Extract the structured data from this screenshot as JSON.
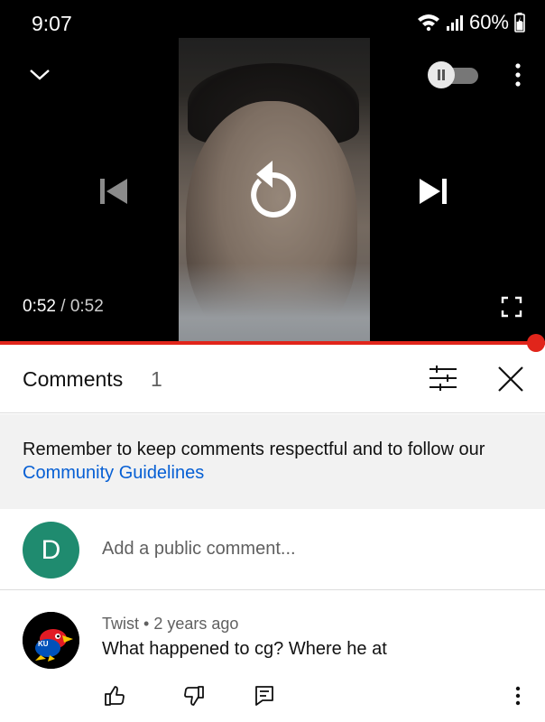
{
  "status_bar": {
    "time": "9:07",
    "battery": "60%",
    "icons": [
      "wifi-icon",
      "signal-icon",
      "battery-icon"
    ]
  },
  "player": {
    "elapsed": "0:52",
    "separator": "/",
    "duration": "0:52",
    "progress_fraction": 1.0,
    "icons": [
      "chevron-down-icon",
      "autoplay-toggle",
      "more-vert-icon",
      "skip-previous-icon",
      "replay-icon",
      "skip-next-icon",
      "fullscreen-icon"
    ]
  },
  "comments": {
    "title": "Comments",
    "count": "1",
    "guidelines_text": "Remember to keep comments respectful and to follow our ",
    "guidelines_link": "Community Guidelines",
    "user_initial": "D",
    "input_placeholder": "Add a public comment...",
    "items": [
      {
        "author": "Twist",
        "dot": "•",
        "age": "2 years ago",
        "text": "What happened to cg? Where he at",
        "avatar": "kansas-jayhawk-logo"
      }
    ]
  },
  "colors": {
    "accent_red": "#e1251b",
    "link_blue": "#065fd4",
    "avatar_green": "#1f8b6f"
  }
}
